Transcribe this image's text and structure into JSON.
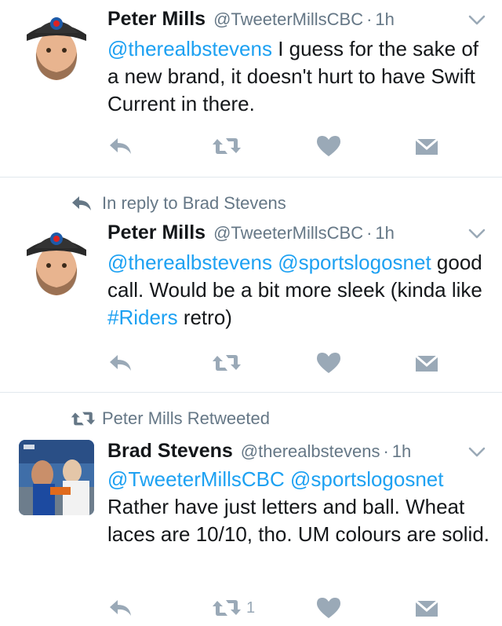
{
  "tweets": [
    {
      "context": null,
      "name": "Peter Mills",
      "handle": "@TweeterMillsCBC",
      "separator": "·",
      "time": "1h",
      "text": [
        {
          "type": "mention",
          "value": "@therealbstevens"
        },
        {
          "type": "text",
          "value": " I guess for the sake of a new brand, it doesn't hurt to have Swift Current in there."
        }
      ],
      "retweet_count": "",
      "icons": {
        "reply": "reply-icon",
        "retweet": "retweet-icon",
        "like": "heart-icon",
        "dm": "direct-message-icon",
        "menu": "chevron-down-icon"
      }
    },
    {
      "context": {
        "icon": "reply-arrow-icon",
        "label": "In reply to Brad Stevens"
      },
      "name": "Peter Mills",
      "handle": "@TweeterMillsCBC",
      "separator": "·",
      "time": "1h",
      "text": [
        {
          "type": "mention",
          "value": "@therealbstevens"
        },
        {
          "type": "text",
          "value": " "
        },
        {
          "type": "mention",
          "value": "@sportslogosnet"
        },
        {
          "type": "text",
          "value": " good call. Would be a bit more sleek (kinda like "
        },
        {
          "type": "hashtag",
          "value": "#Riders"
        },
        {
          "type": "text",
          "value": " retro)"
        }
      ],
      "retweet_count": "",
      "icons": {
        "reply": "reply-icon",
        "retweet": "retweet-icon",
        "like": "heart-icon",
        "dm": "direct-message-icon",
        "menu": "chevron-down-icon"
      }
    },
    {
      "context": {
        "icon": "retweet-icon",
        "label": "Peter Mills Retweeted"
      },
      "name": "Brad Stevens",
      "handle": "@therealbstevens",
      "separator": "·",
      "time": "1h",
      "text": [
        {
          "type": "mention",
          "value": "@TweeterMillsCBC"
        },
        {
          "type": "text",
          "value": " "
        },
        {
          "type": "mention",
          "value": "@sportslogosnet"
        },
        {
          "type": "text",
          "value": " Rather have just letters and ball. Wheat laces are 10/10, tho. UM colours are solid."
        }
      ],
      "retweet_count": "1",
      "icons": {
        "reply": "reply-icon",
        "retweet": "retweet-icon",
        "like": "heart-icon",
        "dm": "direct-message-icon",
        "menu": "chevron-down-icon"
      }
    }
  ],
  "colors": {
    "link": "#1da1f2",
    "muted": "#657786",
    "icon": "#9aa9b7",
    "divider": "#e1e8ed",
    "text": "#14171a"
  }
}
